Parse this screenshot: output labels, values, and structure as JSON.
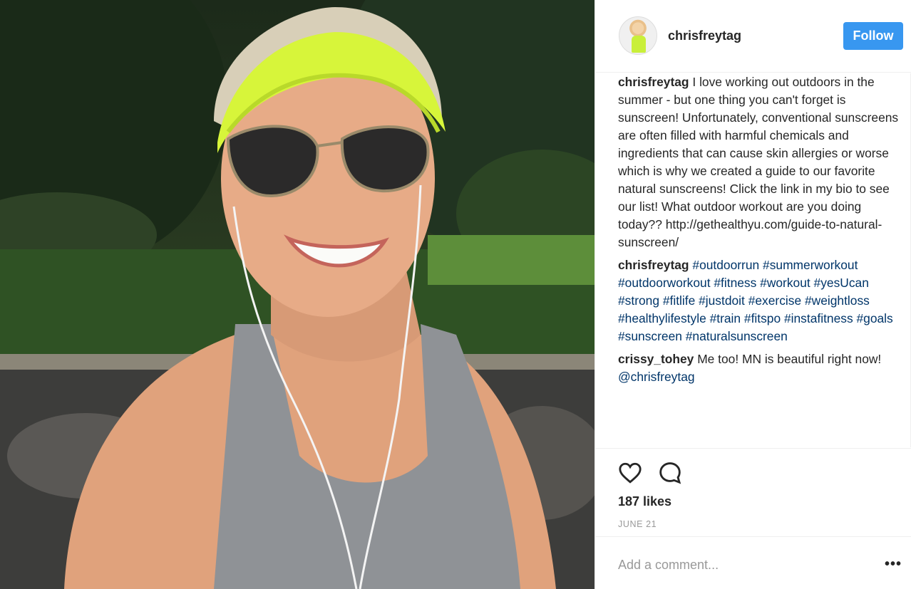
{
  "post": {
    "username": "chrisfreytag",
    "follow_label": "Follow"
  },
  "comments": [
    {
      "user": "chrisfreytag",
      "text": "I love working out outdoors in the summer - but one thing you can't forget is sunscreen! Unfortunately, conventional sunscreens are often filled with harmful chemicals and ingredients that can cause skin allergies or worse which is why we created a guide to our favorite natural sunscreens! Click the link in my bio to see our list! What outdoor workout are you doing today?? http://gethealthyu.com/guide-to-natural-sunscreen/"
    },
    {
      "user": "chrisfreytag",
      "tags": "#outdoorrun #summerworkout #outdoorworkout #fitness #workout #yesUcan #strong #fitlife #justdoit #exercise #weightloss #healthylifestyle #train #fitspo #instafitness #goals #sunscreen #naturalsunscreen"
    },
    {
      "user": "crissy_tohey",
      "text": "Me too! MN is beautiful right now!",
      "mention": "@chrisfreytag"
    }
  ],
  "actions": {
    "like_icon": "heart-icon",
    "comment_icon": "comment-bubble-icon",
    "likes": "187 likes",
    "date": "JUNE 21"
  },
  "add_comment": {
    "placeholder": "Add a comment...",
    "more_label": "•••"
  },
  "colors": {
    "follow_button": "#3897f0",
    "hashtag": "#003569",
    "visor": "#d7f53a"
  }
}
